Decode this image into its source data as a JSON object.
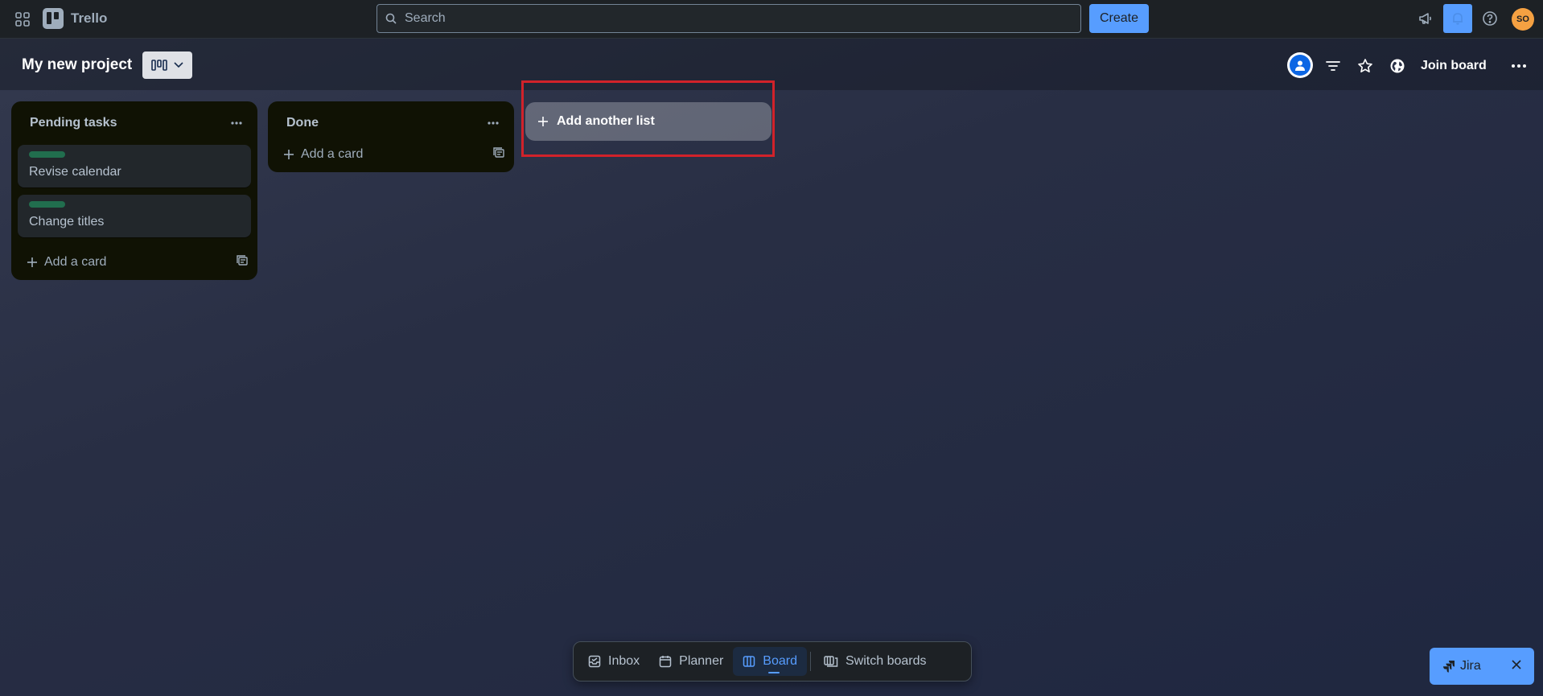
{
  "app": {
    "name": "Trello"
  },
  "search": {
    "placeholder": "Search"
  },
  "topbar": {
    "create_label": "Create",
    "avatar_initials": "SO"
  },
  "board": {
    "title": "My new project",
    "join_label": "Join board"
  },
  "lists": [
    {
      "title": "Pending tasks",
      "cards": [
        {
          "title": "Revise calendar",
          "label_color": "#216e4e"
        },
        {
          "title": "Change titles",
          "label_color": "#216e4e"
        }
      ],
      "add_card_label": "Add a card"
    },
    {
      "title": "Done",
      "cards": [],
      "add_card_label": "Add a card"
    }
  ],
  "add_list_label": "Add another list",
  "bottom_nav": {
    "inbox": "Inbox",
    "planner": "Planner",
    "board": "Board",
    "switch_boards": "Switch boards",
    "active": "Board"
  },
  "jira": {
    "label": "Jira"
  },
  "colors": {
    "accent": "#579dff",
    "highlight": "#d1222a",
    "avatar": "#f5a142"
  }
}
